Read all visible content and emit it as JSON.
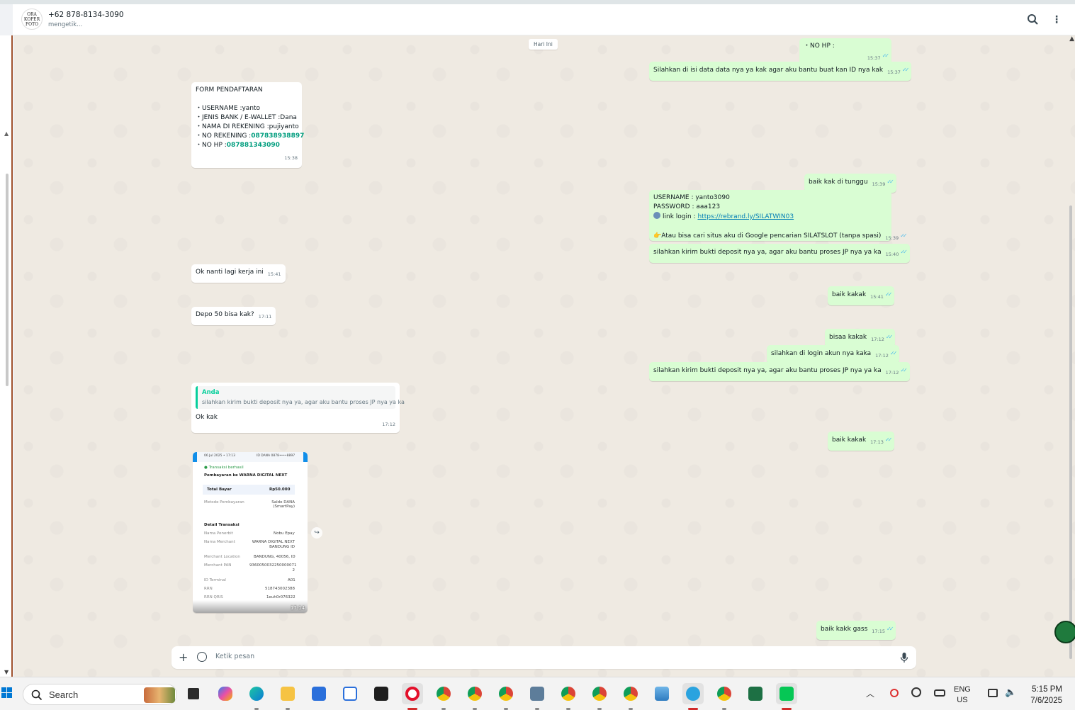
{
  "header": {
    "avatar_text": "ORA KOPER FOTO",
    "contact_name": "+62 878-8134-3090",
    "contact_status": "mengetik...",
    "search_icon": "search-icon",
    "menu_icon": "kebab-menu-icon"
  },
  "chat": {
    "date_chip": "Hari Ini",
    "messages": [
      {
        "id": "m0",
        "dir": "out",
        "text": "・NO HP :",
        "time": "15:37",
        "ticks": "✓✓"
      },
      {
        "id": "m1",
        "dir": "out",
        "text": "Silahkan di isi data data nya ya kak agar aku bantu buat kan ID nya kak",
        "time": "15:37",
        "ticks": "✓✓"
      },
      {
        "id": "m2",
        "dir": "in",
        "time": "15:38",
        "title": "FORM PENDAFTARAN",
        "lines": [
          {
            "label": "・USERNAME :",
            "value": "yanto",
            "green": false
          },
          {
            "label": "・JENIS BANK / E-WALLET :",
            "value": "Dana",
            "green": false
          },
          {
            "label": "・NAMA DI REKENING :",
            "value": "pujiyanto",
            "green": false
          },
          {
            "label": "・NO REKENING :",
            "value": "087838938897",
            "green": true
          },
          {
            "label": "・NO HP :",
            "value": "087881343090",
            "green": true
          }
        ]
      },
      {
        "id": "m3",
        "dir": "out",
        "text": "baik kak di tunggu",
        "time": "15:39",
        "ticks": "✓✓"
      },
      {
        "id": "m4",
        "dir": "out",
        "time": "15:39",
        "ticks": "✓✓",
        "username_line": "USERNAME : yanto3090",
        "password_line": "PASSWORD : aaa123",
        "link_label": "link login : ",
        "link_url": "https://rebrand.ly/SILATWIN03",
        "footer_line": "Atau bisa cari situs aku di Google pencarian SILATSLOT (tanpa spasi)"
      },
      {
        "id": "m5",
        "dir": "out",
        "text": "silahkan kirim bukti deposit nya ya, agar aku bantu proses JP nya ya ka",
        "time": "15:40",
        "ticks": "✓✓"
      },
      {
        "id": "m6",
        "dir": "in",
        "text": "Ok nanti lagi kerja ini",
        "time": "15:41"
      },
      {
        "id": "m7",
        "dir": "out",
        "text": "baik kakak",
        "time": "15:41",
        "ticks": "✓✓"
      },
      {
        "id": "m8",
        "dir": "in",
        "text": "Depo 50 bisa kak?",
        "time": "17:11"
      },
      {
        "id": "m9",
        "dir": "out",
        "text": "bisaa kakak",
        "time": "17:12",
        "ticks": "✓✓"
      },
      {
        "id": "m10",
        "dir": "out",
        "text": "silahkan di login akun nya kaka",
        "time": "17:12",
        "ticks": "✓✓"
      },
      {
        "id": "m11",
        "dir": "out",
        "text": "silahkan kirim bukti deposit nya ya, agar aku bantu proses JP nya ya ka",
        "time": "17:12",
        "ticks": "✓✓"
      },
      {
        "id": "m12",
        "dir": "in",
        "time": "17:12",
        "quote_name": "Anda",
        "quote_text": "silahkan kirim bukti deposit nya ya, agar aku bantu proses JP nya ya ka",
        "text": "Ok kak"
      },
      {
        "id": "m13",
        "dir": "out",
        "text": "baik kakak",
        "time": "17:13",
        "ticks": "✓✓"
      },
      {
        "id": "m14",
        "dir": "out",
        "text": "baik kakk gass",
        "time": "17:15",
        "ticks": "✓✓"
      }
    ],
    "receipt": {
      "time": "17:14",
      "header_date": "06 Jul 2025 • 17:13",
      "header_id": "ID DANA 0878••••8897",
      "status": "Transaksi berhasil",
      "title": "Pembayaran ke WARNA DIGITAL NEXT",
      "total_label": "Total Bayar",
      "total_value": "Rp50.000",
      "method_label": "Metode Pembayaran",
      "method_value": "Saldo DANA (SmartPay)",
      "detail_title": "Detail Transaksi",
      "rows": [
        {
          "k": "Nama Penerbit",
          "v": "Nobu Epay"
        },
        {
          "k": "Nama Merchant",
          "v": "WARNA DIGITAL NEXT BANDUNG ID"
        },
        {
          "k": "Merchant Location",
          "v": "BANDUNG, 40056, ID"
        },
        {
          "k": "Merchant PAN",
          "v": "9360050032250000071 2"
        },
        {
          "k": "ID Terminal",
          "v": "A01"
        },
        {
          "k": "RRN",
          "v": "518743002388"
        },
        {
          "k": "RRN QRIS",
          "v": "1euh0r076322"
        }
      ]
    }
  },
  "composer": {
    "placeholder": "Ketik pesan"
  },
  "taskbar": {
    "search_label": "Search",
    "lang_top": "ENG",
    "lang_bottom": "US",
    "time": "5:15 PM",
    "date": "7/6/2025",
    "apps": [
      "task-view",
      "copilot",
      "edge",
      "file-explorer",
      "store",
      "app-6",
      "app-7",
      "opera",
      "chrome-1",
      "chrome-2",
      "chrome-3",
      "app-12",
      "chrome-4",
      "chrome-5",
      "chrome-6",
      "app-16",
      "telegram",
      "chrome-7",
      "excel",
      "line"
    ]
  },
  "colors": {
    "outgoing": "#d9fdd3",
    "incoming": "#ffffff",
    "accent": "#009d7e",
    "tick": "#53bdeb"
  }
}
